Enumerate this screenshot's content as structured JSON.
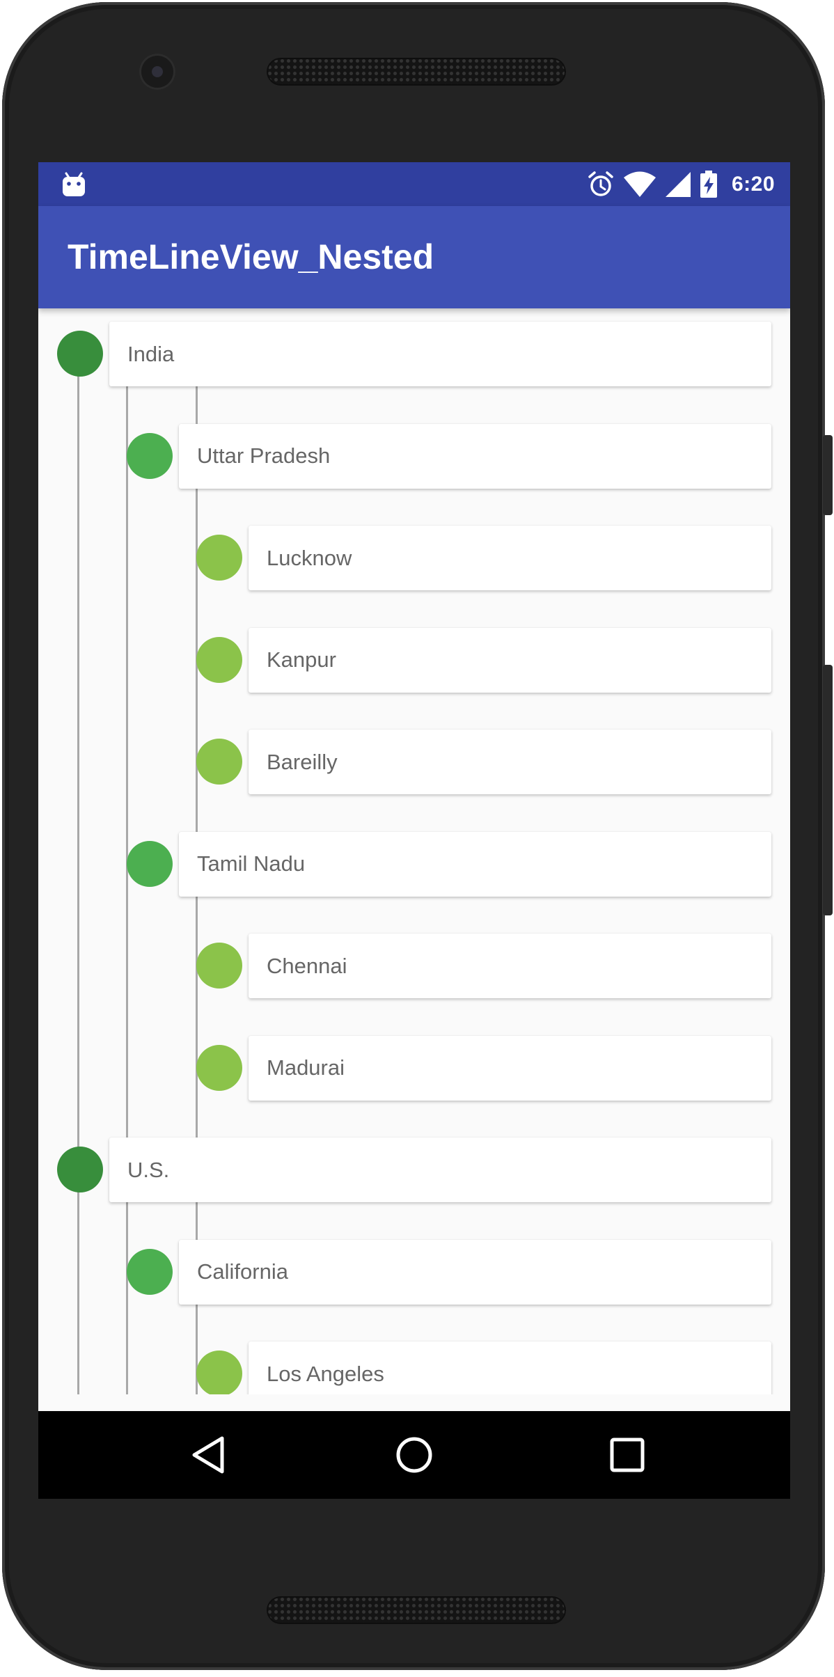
{
  "app": {
    "title": "TimeLineView_Nested"
  },
  "status_bar": {
    "time": "6:20",
    "icons": [
      "android-debug-icon",
      "alarm-icon",
      "wifi-icon",
      "cell-signal-icon",
      "battery-charging-icon"
    ]
  },
  "colors": {
    "status_bar": "#303f9f",
    "app_bar": "#3f51b5",
    "level_0_node": "#388e3c",
    "level_1_node": "#4caf50",
    "level_2_node": "#8bc34a",
    "timeline_line": "#a8a8a8"
  },
  "timeline": {
    "items": [
      {
        "label": "India",
        "level": 0
      },
      {
        "label": "Uttar Pradesh",
        "level": 1
      },
      {
        "label": "Lucknow",
        "level": 2
      },
      {
        "label": "Kanpur",
        "level": 2
      },
      {
        "label": "Bareilly",
        "level": 2
      },
      {
        "label": "Tamil Nadu",
        "level": 1
      },
      {
        "label": "Chennai",
        "level": 2
      },
      {
        "label": "Madurai",
        "level": 2
      },
      {
        "label": "U.S.",
        "level": 0
      },
      {
        "label": "California",
        "level": 1
      },
      {
        "label": "Los Angeles",
        "level": 2
      }
    ]
  },
  "nav_bar": {
    "buttons": [
      "back-icon",
      "home-icon",
      "recents-icon"
    ]
  }
}
